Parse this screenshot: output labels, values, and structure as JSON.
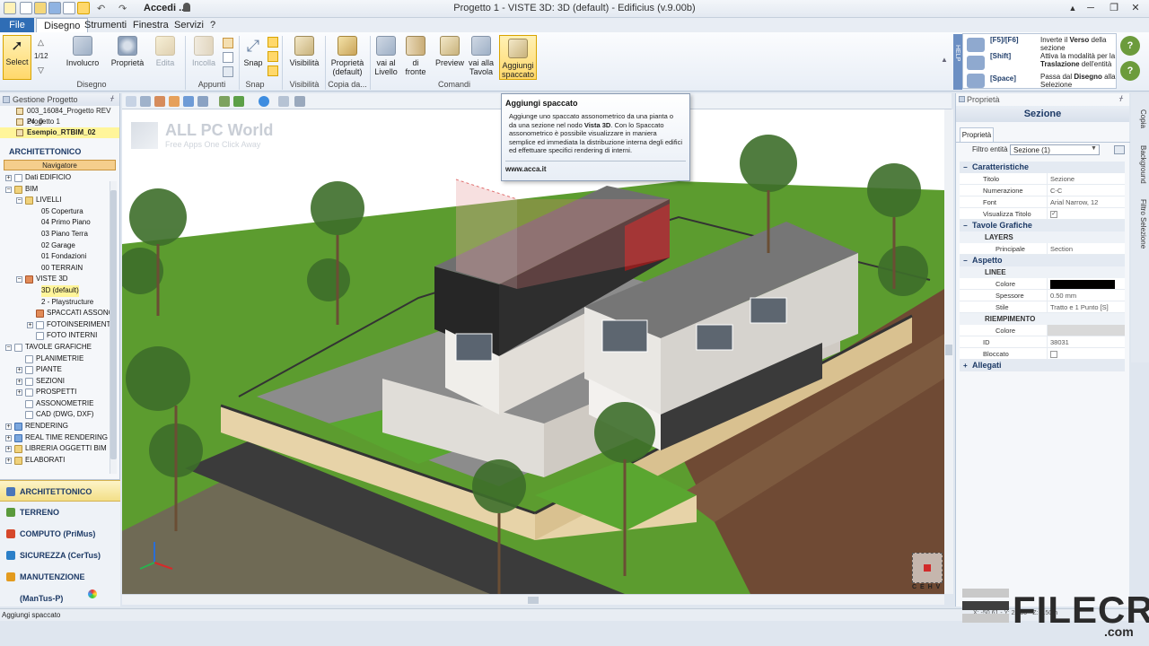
{
  "titlebar": {
    "user_label": "Accedi ...",
    "title": "Progetto 1 -  VISTE 3D: 3D (default) - Edificius (v.9.00b)",
    "minimize": "─",
    "restore": "❐",
    "close": "✕",
    "help_glyph": "?"
  },
  "tabs": [
    "File",
    "Disegno",
    "Strumenti",
    "Finestra",
    "Servizi",
    "?"
  ],
  "ribbon": {
    "select": "Select",
    "select_counter": "1/12",
    "involucro": "Involucro",
    "proprieta": "Proprietà",
    "edita": "Edita",
    "incolla": "Incolla",
    "snap": "Snap",
    "visibilita": "Visibilità",
    "proprieta_default": "Proprietà (default)",
    "vai_livello": "vai al Livello",
    "di_fronte": "di fronte",
    "preview": "Preview",
    "vai_tavola": "vai alla Tavola",
    "aggiungi_spaccato": "Aggiungi spaccato",
    "groups": {
      "disegno": "Disegno",
      "appunti": "Appunti",
      "snap": "Snap",
      "visibilita": "Visibilità",
      "copia": "Copia da...",
      "comandi": "Comandi"
    }
  },
  "help": {
    "side_label": "HELP",
    "items": [
      {
        "key": "[F5]/[F6]",
        "desc_pre": "Inverte il ",
        "desc_bold": "Verso",
        "desc_post": " della sezione"
      },
      {
        "key": "[Shift]",
        "desc_pre": "Attiva la modalità per la ",
        "desc_bold": "Traslazione",
        "desc_post": " dell'entità"
      },
      {
        "key": "[Space]",
        "desc_pre": "Passa dal ",
        "desc_bold": "Disegno",
        "desc_post": " alla Selezione"
      }
    ]
  },
  "left_panel": {
    "header": "Gestione Progetto",
    "projects": [
      {
        "label": "003_16084_Progetto REV 24_0",
        "selected": false
      },
      {
        "label": "Progetto 1",
        "selected": false
      },
      {
        "label": "Esempio_RTBIM_02",
        "selected": true
      }
    ],
    "section": "ARCHITETTONICO",
    "navigator": "Navigatore",
    "tree": [
      {
        "label": "Dati EDIFICIO",
        "level": 0,
        "exp": "+",
        "icon": "doc"
      },
      {
        "label": "BIM",
        "level": 0,
        "exp": "−",
        "icon": "fold"
      },
      {
        "label": "LIVELLI",
        "level": 1,
        "exp": "−",
        "icon": "fold"
      },
      {
        "label": "05 Copertura",
        "level": 2,
        "exp": "",
        "icon": ""
      },
      {
        "label": "04 Primo Piano",
        "level": 2,
        "exp": "",
        "icon": ""
      },
      {
        "label": "03 Piano Terra",
        "level": 2,
        "exp": "",
        "icon": ""
      },
      {
        "label": "02 Garage",
        "level": 2,
        "exp": "",
        "icon": ""
      },
      {
        "label": "01 Fondazioni",
        "level": 2,
        "exp": "",
        "icon": ""
      },
      {
        "label": "00 TERRAIN",
        "level": 2,
        "exp": "",
        "icon": ""
      },
      {
        "label": "VISTE 3D",
        "level": 1,
        "exp": "−",
        "icon": "red"
      },
      {
        "label": "3D (default)",
        "level": 2,
        "exp": "",
        "icon": "",
        "selected": true
      },
      {
        "label": "2 - Playstructure",
        "level": 2,
        "exp": "",
        "icon": ""
      },
      {
        "label": "SPACCATI ASSONO",
        "level": 2,
        "exp": "",
        "icon": "red"
      },
      {
        "label": "FOTOINSERIMENTI",
        "level": 2,
        "exp": "+",
        "icon": "doc"
      },
      {
        "label": "FOTO INTERNI",
        "level": 2,
        "exp": "",
        "icon": "doc"
      },
      {
        "label": "TAVOLE GRAFICHE",
        "level": 0,
        "exp": "−",
        "icon": "doc"
      },
      {
        "label": "PLANIMETRIE",
        "level": 1,
        "exp": "",
        "icon": "doc"
      },
      {
        "label": "PIANTE",
        "level": 1,
        "exp": "+",
        "icon": "doc"
      },
      {
        "label": "SEZIONI",
        "level": 1,
        "exp": "+",
        "icon": "doc"
      },
      {
        "label": "PROSPETTI",
        "level": 1,
        "exp": "+",
        "icon": "doc"
      },
      {
        "label": "ASSONOMETRIE",
        "level": 1,
        "exp": "",
        "icon": "doc"
      },
      {
        "label": "CAD (DWG, DXF)",
        "level": 1,
        "exp": "",
        "icon": "doc"
      },
      {
        "label": "RENDERING",
        "level": 0,
        "exp": "+",
        "icon": "blue"
      },
      {
        "label": "REAL TIME RENDERING",
        "level": 0,
        "exp": "+",
        "icon": "blue"
      },
      {
        "label": "LIBRERIA OGGETTI BIM",
        "level": 0,
        "exp": "+",
        "icon": "fold"
      },
      {
        "label": "ELABORATI",
        "level": 0,
        "exp": "+",
        "icon": "fold"
      }
    ],
    "modules": [
      {
        "label": "ARCHITETTONICO",
        "active": true,
        "color": "#4a76b9"
      },
      {
        "label": "TERRENO",
        "active": false,
        "color": "#5b9a3c"
      },
      {
        "label": "COMPUTO (PriMus)",
        "active": false,
        "color": "#d6482b"
      },
      {
        "label": "SICUREZZA (CerTus)",
        "active": false,
        "color": "#2b7fc8"
      },
      {
        "label": "MANUTENZIONE (ManTus-P)",
        "active": false,
        "color": "#e39b1f"
      }
    ]
  },
  "tooltip": {
    "title": "Aggiungi spaccato",
    "body_pre": "Aggiunge uno spaccato assonometrico da una pianta o da una sezione nel nodo ",
    "body_bold": "Vista 3D",
    "body_post": ". Con lo Spaccato assonometrico è possibile visualizzare in maniera semplice ed immediata la distribuzione interna degli edifici ed effettuare specifici rendering di interni.",
    "link": "www.acca.it"
  },
  "watermark": {
    "title": "ALL PC World",
    "subtitle": "Free Apps One Click Away"
  },
  "viewcube": {
    "label": "C E H V"
  },
  "properties": {
    "header": "Proprietà",
    "title": "Sezione",
    "tab": "Proprietà",
    "filter_label": "Filtro entità",
    "filter_value": "Sezione (1)",
    "categories": [
      {
        "name": "Caratteristiche",
        "rows": [
          {
            "k": "Titolo",
            "v": "Sezione"
          },
          {
            "k": "Numerazione",
            "v": "C-C"
          },
          {
            "k": "Font",
            "v": "Arial Narrow, 12"
          },
          {
            "k": "Visualizza Titolo",
            "v": "✓"
          }
        ]
      },
      {
        "name": "Tavole Grafiche",
        "sub": "LAYERS",
        "rows": [
          {
            "k": "Principale",
            "v": "Section"
          }
        ]
      },
      {
        "name": "Aspetto",
        "sub": "LINEE",
        "rows": [
          {
            "k": "Colore",
            "v": ""
          },
          {
            "k": "Spessore",
            "v": "0.50 mm"
          },
          {
            "k": "Stile",
            "v": "Tratto e 1 Punto [S]"
          }
        ],
        "sub2": "RIEMPIMENTO",
        "rows2": [
          {
            "k": "Colore",
            "v": ""
          }
        ],
        "rows3": [
          {
            "k": "ID",
            "v": "38031"
          },
          {
            "k": "Bloccato",
            "v": ""
          }
        ]
      },
      {
        "name": "Allegati",
        "rows": []
      }
    ]
  },
  "side_tabs": [
    "Copia",
    "Background",
    "Filtro Selezione"
  ],
  "status": {
    "text": "Aggiungi spaccato",
    "coords": "X: -50.61 - Y: 25.00 - Z: 1.50m"
  },
  "badge": {
    "name": "FILECR",
    "domain": ".com"
  },
  "colors": {
    "accent": "#2f6db5",
    "selection": "#fff59a",
    "navigator": "#f5ce8c",
    "grass": "#5c9c2f",
    "facade": "#e8e6e2",
    "roof": "#5a5a5a"
  }
}
